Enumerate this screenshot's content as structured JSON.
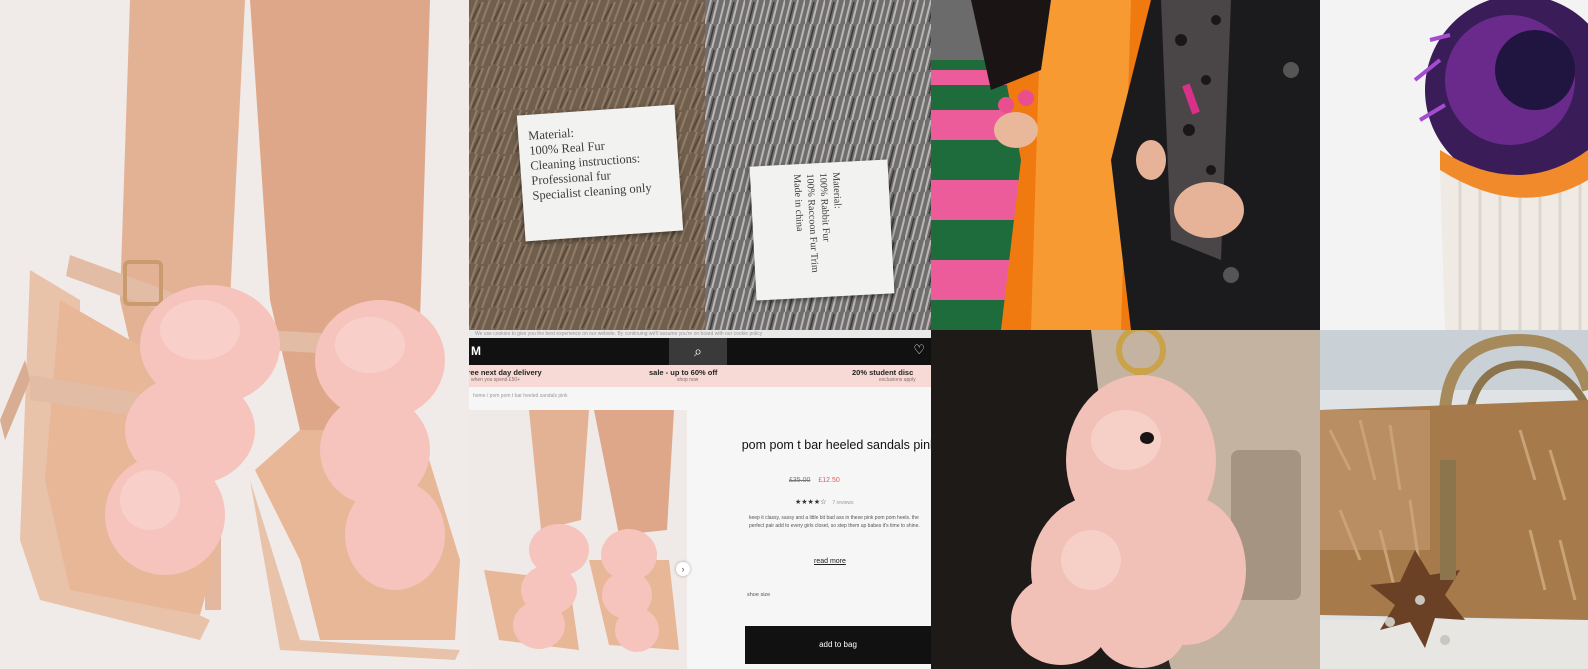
{
  "labels": {
    "label_one": {
      "lines": [
        "Material:",
        "100% Real Fur",
        "Cleaning instructions:",
        "Professional fur",
        "Specialist cleaning only"
      ]
    },
    "label_two": {
      "lines": [
        "Material:",
        "100% Rabbit Fur",
        "100% Raccoon Fur Trim",
        "Made in china"
      ]
    }
  },
  "shop": {
    "top_strip": "We use cookies to give you the best experience on our website. By continuing we'll assume you're on board with our cookie policy",
    "logo": "M",
    "search_icon": "⌕",
    "heart_icon": "♡",
    "promos": [
      {
        "title": "free next day delivery",
        "sub": "when you spend £50+"
      },
      {
        "title": "sale - up to 60% off",
        "sub": "shop now"
      },
      {
        "title": "20% student disc",
        "sub": "exclusions apply"
      }
    ],
    "breadcrumb": "home / pom pom t bar heeled sandals pink",
    "product_title": "pom pom t bar heeled sandals pink",
    "price_old": "£35.00",
    "price_new": "£12.50",
    "rating": "★★★★☆",
    "reviews": "7 reviews",
    "description": "keep it classy, sassy and a little bit bad ass in these pink pom pom heels. the perfect pair add to every girls closet, so step them up babes it's time to shine.",
    "read_more": "read more",
    "show_size": "shoe size",
    "add_to_bag": "add to bag"
  },
  "colors": {
    "pom_pink": "#f6c4bc",
    "scarf_orange": "#f58a1f",
    "bag_fur": "#a67a4a"
  }
}
